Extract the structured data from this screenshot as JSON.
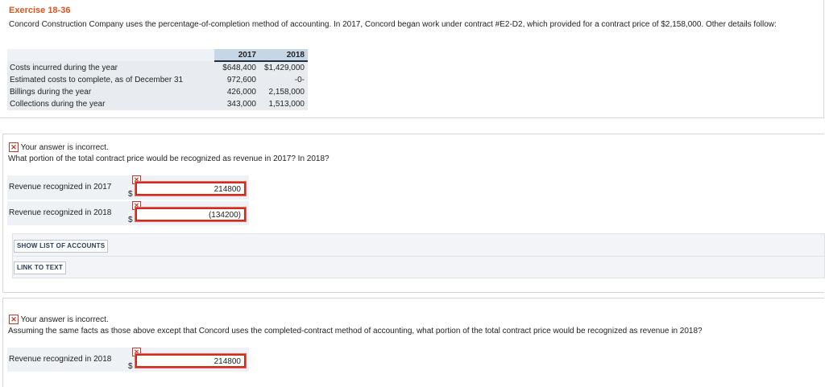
{
  "exercise": {
    "title": "Exercise 18-36",
    "intro": "Concord Construction Company uses the percentage-of-completion method of accounting. In 2017, Concord began work under contract #E2-D2, which provided for a contract price of $2,158,000. Other details follow:"
  },
  "table": {
    "headers": [
      "2017",
      "2018"
    ],
    "rows": [
      {
        "label": "Costs incurred during the year",
        "y2017": "$648,400",
        "y2018": "$1,429,000"
      },
      {
        "label": "Estimated costs to complete, as of December 31",
        "y2017": "972,600",
        "y2018": "-0-"
      },
      {
        "label": "Billings during the year",
        "y2017": "426,000",
        "y2018": "2,158,000"
      },
      {
        "label": "Collections during the year",
        "y2017": "343,000",
        "y2018": "1,513,000"
      }
    ]
  },
  "part1": {
    "status": "Your answer is incorrect.",
    "question": "What portion of the total contract price would be recognized as revenue in 2017? In 2018?",
    "rows": [
      {
        "label": "Revenue recognized in 2017",
        "currency": "$",
        "value": "214800"
      },
      {
        "label": "Revenue recognized in 2018",
        "currency": "$",
        "value": "(134200)"
      }
    ]
  },
  "buttons": {
    "show_accounts": "SHOW LIST OF ACCOUNTS",
    "link_to_text": "LINK TO TEXT"
  },
  "part2": {
    "status": "Your answer is incorrect.",
    "question": "Assuming the same facts as those above except that Concord uses the completed-contract method of accounting, what portion of the total contract price would be recognized as revenue in 2018?",
    "rows": [
      {
        "label": "Revenue recognized in 2018",
        "currency": "$",
        "value": "214800"
      }
    ]
  },
  "icons": {
    "incorrect": "x-mark-icon"
  },
  "colors": {
    "title": "#d9541e",
    "error": "#d12a1e",
    "table_header": "#c6d6e4"
  }
}
